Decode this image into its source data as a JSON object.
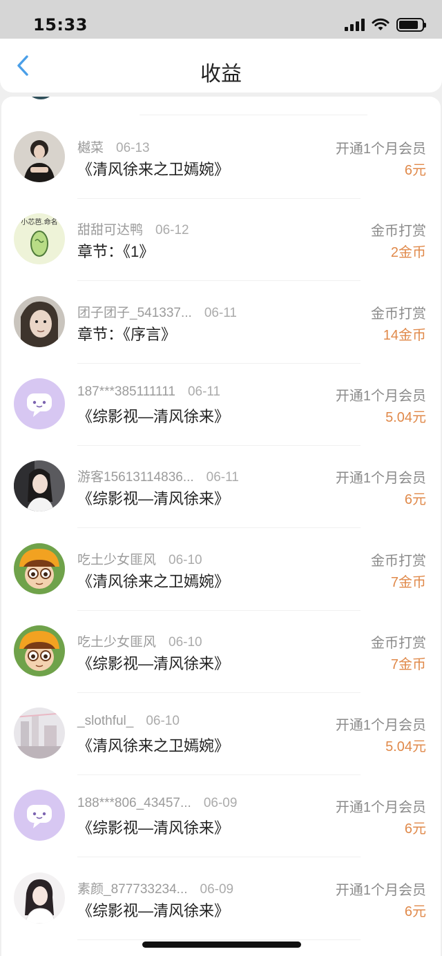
{
  "status_bar": {
    "time": "15:33",
    "battery_level": 0.85
  },
  "nav": {
    "title": "收益",
    "back_icon": "chevron-left-icon"
  },
  "colors": {
    "accent_blue": "#4a9fe8",
    "amount_orange": "#e0894a",
    "meta_gray": "#9b9b9b"
  },
  "records": [
    {
      "user": "樾菜",
      "date": "06-13",
      "title": "《清风徐来之卫嫣婉》",
      "type": "开通1个月会员",
      "amount": "6元",
      "avatar": "photo-dark"
    },
    {
      "user": "甜甜可达鸭",
      "date": "06-12",
      "title": "章节：《1》",
      "type": "金币打赏",
      "amount": "2金币",
      "avatar": "doodle",
      "avatar_text": "小芯芭.命名"
    },
    {
      "user": "团子团子_541337...",
      "date": "06-11",
      "title": "章节：《序言》",
      "type": "金币打赏",
      "amount": "14金币",
      "avatar": "photo-face"
    },
    {
      "user": "187***385111111",
      "date": "06-11",
      "title": "《综影视—清风徐来》",
      "type": "开通1个月会员",
      "amount": "5.04元",
      "avatar": "default-chat"
    },
    {
      "user": "游客15613114836...",
      "date": "06-11",
      "title": "《综影视—清风徐来》",
      "type": "开通1个月会员",
      "amount": "6元",
      "avatar": "photo-girl"
    },
    {
      "user": "吃土少女匪风",
      "date": "06-10",
      "title": "《清风徐来之卫嫣婉》",
      "type": "金币打赏",
      "amount": "7金币",
      "avatar": "cartoon"
    },
    {
      "user": "吃土少女匪风",
      "date": "06-10",
      "title": "《综影视—清风徐来》",
      "type": "金币打赏",
      "amount": "7金币",
      "avatar": "cartoon"
    },
    {
      "user": "_slothful_",
      "date": "06-10",
      "title": "《清风徐来之卫嫣婉》",
      "type": "开通1个月会员",
      "amount": "5.04元",
      "avatar": "photo-scene"
    },
    {
      "user": "188***806_43457...",
      "date": "06-09",
      "title": "《综影视—清风徐来》",
      "type": "开通1个月会员",
      "amount": "6元",
      "avatar": "default-chat"
    },
    {
      "user": "素颜_877733234...",
      "date": "06-09",
      "title": "《综影视—清风徐来》",
      "type": "开通1个月会员",
      "amount": "6元",
      "avatar": "photo-light"
    }
  ]
}
